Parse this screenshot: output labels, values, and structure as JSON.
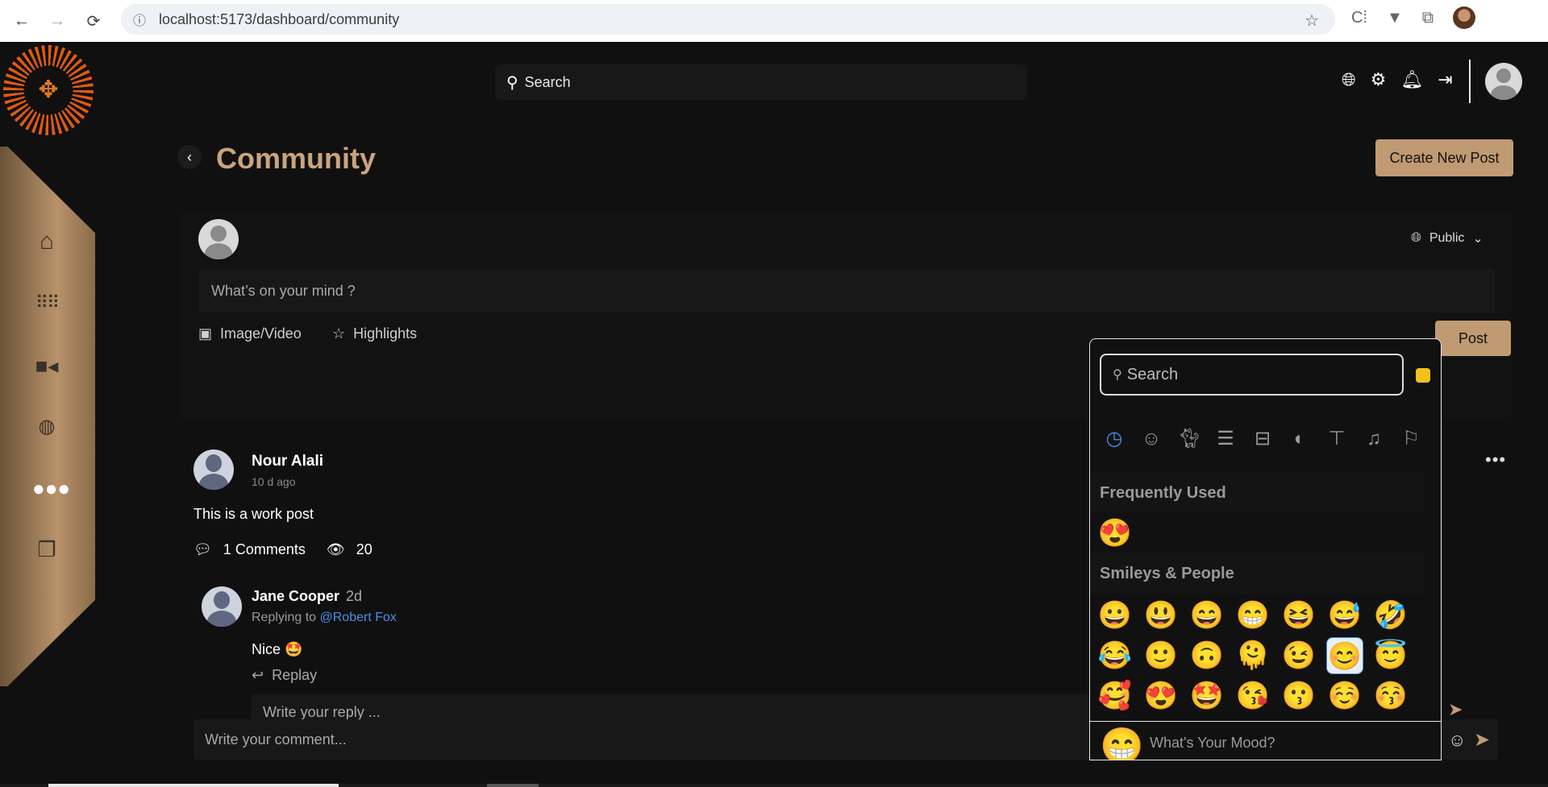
{
  "browser": {
    "url": "localhost:5173/dashboard/community",
    "back_icon": "←",
    "forward_icon": "→",
    "reload_icon": "⟳"
  },
  "header": {
    "search_placeholder": "Search",
    "icons": [
      "globe-icon",
      "gear-icon",
      "bell-icon",
      "logout-icon"
    ]
  },
  "sidebar": {
    "items": [
      {
        "name": "home",
        "glyph": "⌂"
      },
      {
        "name": "apps",
        "glyph": "⁞⁞⁞"
      },
      {
        "name": "video",
        "glyph": "▶"
      },
      {
        "name": "chat",
        "glyph": "💬"
      },
      {
        "name": "community",
        "glyph": "👥"
      },
      {
        "name": "library",
        "glyph": "❐"
      }
    ]
  },
  "page": {
    "title": "Community",
    "create_button": "Create New Post"
  },
  "composer": {
    "visibility": "Public",
    "placeholder": "What’s on your mind ?",
    "image_video": "Image/Video",
    "highlights": "Highlights",
    "post_button": "Post"
  },
  "post": {
    "author": "Nour Alali",
    "time": "10 d ago",
    "text": "This is a work post",
    "comments_label": "1 Comments",
    "views": "20",
    "more": "•••"
  },
  "comment": {
    "author": "Jane Cooper",
    "time": "2d",
    "replying_prefix": "Replying to",
    "mention": "@Robert Fox",
    "text": "Nice 🤩",
    "replay_label": "Replay",
    "reply_placeholder": "Write your reply ..."
  },
  "comment_box": {
    "placeholder": "Write your comment..."
  },
  "emoji_picker": {
    "search_placeholder": "Search",
    "categories": [
      "clock",
      "smiley",
      "cat",
      "burger",
      "bus",
      "ball",
      "shirt",
      "music",
      "flag"
    ],
    "frequently_used_label": "Frequently Used",
    "frequently_used": [
      "😍"
    ],
    "smileys_label": "Smileys & People",
    "smileys": [
      [
        "😀",
        "😃",
        "😄",
        "😁",
        "😆",
        "😅",
        "🤣"
      ],
      [
        "😂",
        "🙂",
        "🙃",
        "🫠",
        "😉",
        "😊",
        "😇"
      ],
      [
        "🥰",
        "😍",
        "🤩",
        "😘",
        "😗",
        "☺️",
        "😚"
      ]
    ],
    "footer_emoji": "😁",
    "footer_label": "What's Your Mood?",
    "skin_tone_color": "#f2c21a"
  }
}
